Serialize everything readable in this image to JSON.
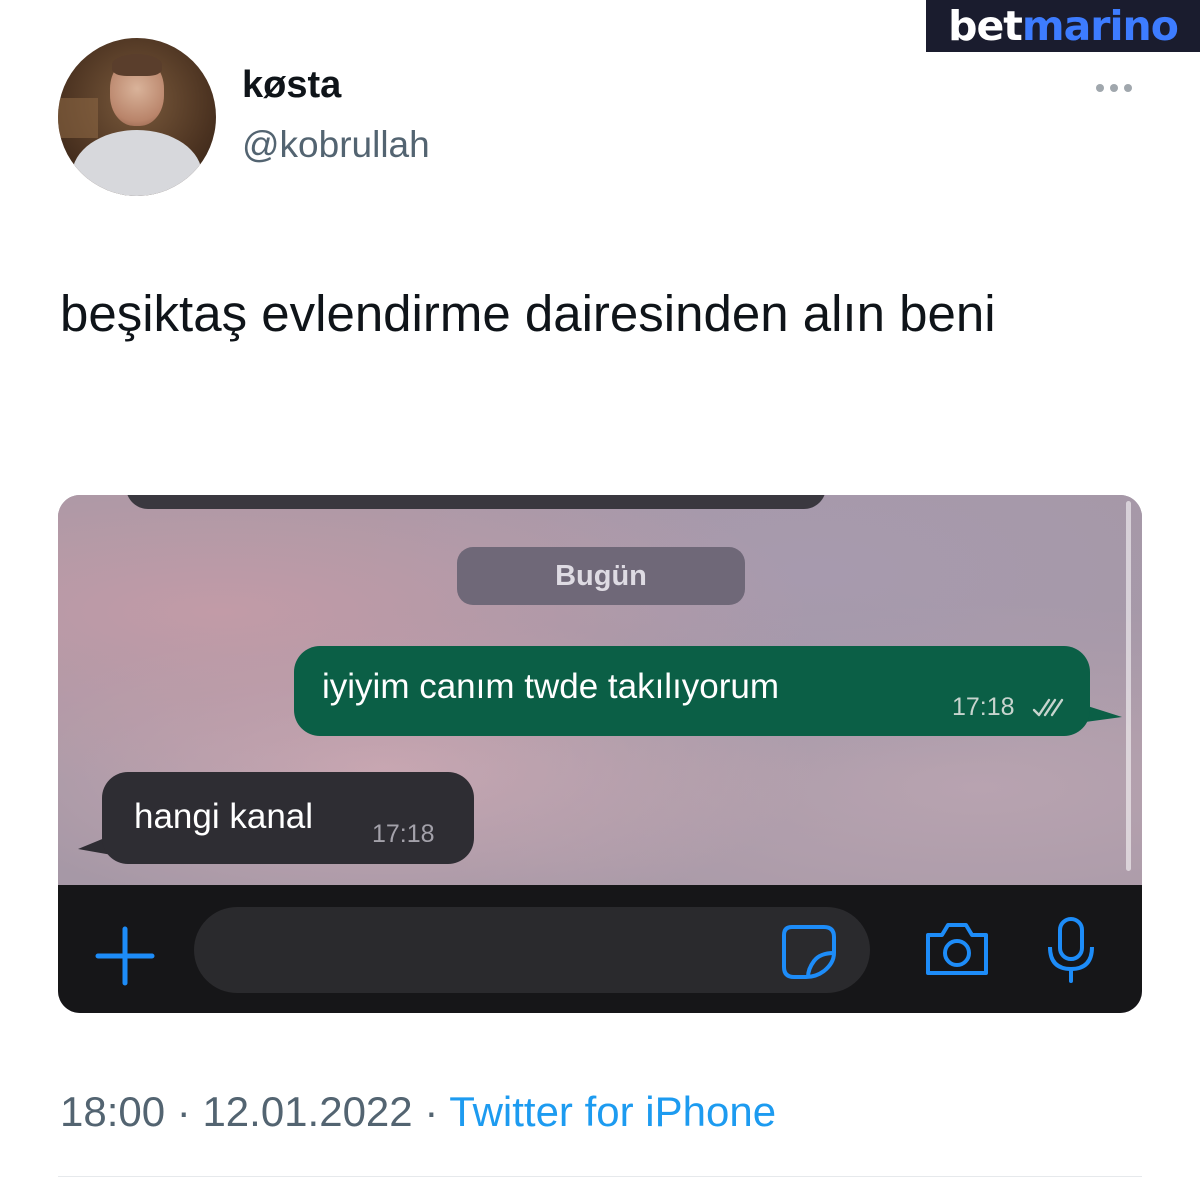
{
  "watermark": {
    "part1": "bet",
    "part2": "marino"
  },
  "author": {
    "avatar_icon": "avatar",
    "name": "køsta",
    "handle": "@kobrullah"
  },
  "tweet": {
    "text": "beşiktaş evlendirme dairesinden alın beni"
  },
  "chat_screenshot": {
    "date_chip": "Bugün",
    "messages": [
      {
        "direction": "outgoing",
        "text": "iyiyim canım twde takılıyorum",
        "time": "17:18",
        "status_icon": "double-check-icon"
      },
      {
        "direction": "incoming",
        "text": "hangi kanal",
        "time": "17:18"
      }
    ],
    "input_bar": {
      "icons": [
        "plus-icon",
        "sticker-icon",
        "camera-icon",
        "microphone-icon"
      ],
      "accent_color": "#1d8cf8"
    }
  },
  "meta": {
    "time": "18:00",
    "sep1": " · ",
    "date": "12.01.2022",
    "sep2": " · ",
    "source": "Twitter for iPhone"
  },
  "colors": {
    "source_link": "#1d9bf0",
    "outgoing_bubble": "#0b5f46",
    "incoming_bubble": "#2e2d33"
  }
}
